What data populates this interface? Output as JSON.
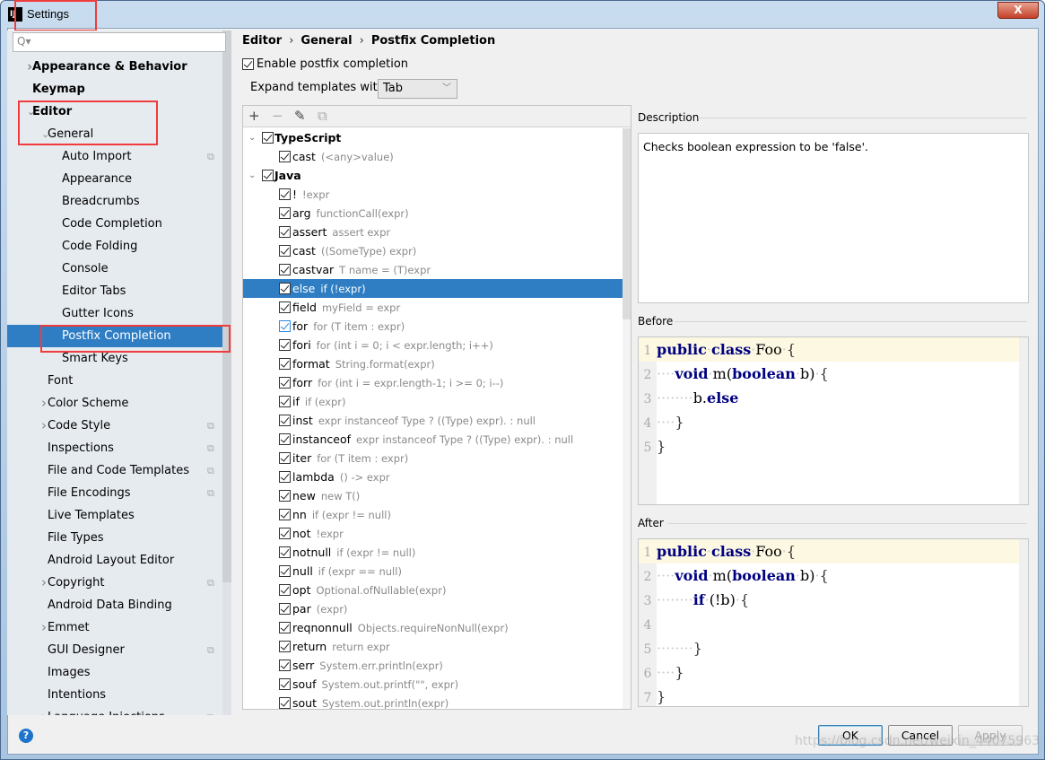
{
  "window": {
    "title": "Settings",
    "close_label": "X"
  },
  "search": {
    "placeholder": "Q▾"
  },
  "sidebar": {
    "items": [
      {
        "label": "Appearance & Behavior",
        "level": 0,
        "bold": true,
        "arrow": "collapsed"
      },
      {
        "label": "Keymap",
        "level": 0,
        "bold": true
      },
      {
        "label": "Editor",
        "level": 0,
        "bold": true,
        "arrow": "expanded"
      },
      {
        "label": "General",
        "level": 1,
        "arrow": "expanded"
      },
      {
        "label": "Auto Import",
        "level": 2,
        "copy": true
      },
      {
        "label": "Appearance",
        "level": 2
      },
      {
        "label": "Breadcrumbs",
        "level": 2
      },
      {
        "label": "Code Completion",
        "level": 2
      },
      {
        "label": "Code Folding",
        "level": 2
      },
      {
        "label": "Console",
        "level": 2
      },
      {
        "label": "Editor Tabs",
        "level": 2
      },
      {
        "label": "Gutter Icons",
        "level": 2
      },
      {
        "label": "Postfix Completion",
        "level": 2,
        "selected": true
      },
      {
        "label": "Smart Keys",
        "level": 2
      },
      {
        "label": "Font",
        "level": 1
      },
      {
        "label": "Color Scheme",
        "level": 1,
        "arrow": "collapsed"
      },
      {
        "label": "Code Style",
        "level": 1,
        "arrow": "collapsed",
        "copy": true
      },
      {
        "label": "Inspections",
        "level": 1,
        "copy": true
      },
      {
        "label": "File and Code Templates",
        "level": 1,
        "copy": true
      },
      {
        "label": "File Encodings",
        "level": 1,
        "copy": true
      },
      {
        "label": "Live Templates",
        "level": 1
      },
      {
        "label": "File Types",
        "level": 1
      },
      {
        "label": "Android Layout Editor",
        "level": 1
      },
      {
        "label": "Copyright",
        "level": 1,
        "arrow": "collapsed",
        "copy": true
      },
      {
        "label": "Android Data Binding",
        "level": 1
      },
      {
        "label": "Emmet",
        "level": 1,
        "arrow": "collapsed"
      },
      {
        "label": "GUI Designer",
        "level": 1,
        "copy": true
      },
      {
        "label": "Images",
        "level": 1
      },
      {
        "label": "Intentions",
        "level": 1
      },
      {
        "label": "Language Injections",
        "level": 1,
        "arrow": "collapsed",
        "copy": true
      }
    ]
  },
  "breadcrumb": [
    "Editor",
    "General",
    "Postfix Completion"
  ],
  "enable": {
    "label": "Enable postfix completion",
    "checked": true
  },
  "expand": {
    "label": "Expand templates with",
    "value": "Tab"
  },
  "toolbar": {
    "add": "+",
    "remove": "−",
    "edit": "✎",
    "copy": "⧉"
  },
  "templates": [
    {
      "group": "TypeScript",
      "checked": true,
      "items": [
        {
          "key": "cast",
          "desc": "(<any>value)",
          "checked": true
        }
      ]
    },
    {
      "group": "Java",
      "checked": true,
      "items": [
        {
          "key": "!",
          "desc": "!expr",
          "checked": true
        },
        {
          "key": "arg",
          "desc": "functionCall(expr)",
          "checked": true
        },
        {
          "key": "assert",
          "desc": "assert expr",
          "checked": true
        },
        {
          "key": "cast",
          "desc": "((SomeType) expr)",
          "checked": true
        },
        {
          "key": "castvar",
          "desc": "T name = (T)expr",
          "checked": true
        },
        {
          "key": "else",
          "desc": "if (!expr)",
          "checked": true,
          "selected": true
        },
        {
          "key": "field",
          "desc": "myField = expr",
          "checked": true
        },
        {
          "key": "for",
          "desc": "for (T item : expr)",
          "checked": true,
          "focused": true
        },
        {
          "key": "fori",
          "desc": "for (int i = 0; i < expr.length; i++)",
          "checked": true
        },
        {
          "key": "format",
          "desc": "String.format(expr)",
          "checked": true
        },
        {
          "key": "forr",
          "desc": "for (int i = expr.length-1; i >= 0; i--)",
          "checked": true
        },
        {
          "key": "if",
          "desc": "if (expr)",
          "checked": true
        },
        {
          "key": "inst",
          "desc": "expr instanceof Type ? ((Type) expr). : null",
          "checked": true
        },
        {
          "key": "instanceof",
          "desc": "expr instanceof Type ? ((Type) expr). : null",
          "checked": true
        },
        {
          "key": "iter",
          "desc": "for (T item : expr)",
          "checked": true
        },
        {
          "key": "lambda",
          "desc": "() -> expr",
          "checked": true
        },
        {
          "key": "new",
          "desc": "new T()",
          "checked": true
        },
        {
          "key": "nn",
          "desc": "if (expr != null)",
          "checked": true
        },
        {
          "key": "not",
          "desc": "!expr",
          "checked": true
        },
        {
          "key": "notnull",
          "desc": "if (expr != null)",
          "checked": true
        },
        {
          "key": "null",
          "desc": "if (expr == null)",
          "checked": true
        },
        {
          "key": "opt",
          "desc": "Optional.ofNullable(expr)",
          "checked": true
        },
        {
          "key": "par",
          "desc": "(expr)",
          "checked": true
        },
        {
          "key": "reqnonnull",
          "desc": "Objects.requireNonNull(expr)",
          "checked": true
        },
        {
          "key": "return",
          "desc": "return expr",
          "checked": true
        },
        {
          "key": "serr",
          "desc": "System.err.println(expr)",
          "checked": true
        },
        {
          "key": "souf",
          "desc": "System.out.printf(\"\", expr)",
          "checked": true
        },
        {
          "key": "sout",
          "desc": "System.out.println(expr)",
          "checked": true
        }
      ]
    }
  ],
  "description": {
    "label": "Description",
    "text": "Checks boolean expression to be 'false'."
  },
  "before": {
    "label": "Before",
    "lines": [
      [
        [
          "kw",
          "public"
        ],
        [
          "ws",
          "·"
        ],
        [
          "kw",
          "class"
        ],
        [
          "ws",
          "·"
        ],
        [
          "",
          "Foo"
        ],
        [
          "ws",
          "·"
        ],
        [
          "br",
          "{"
        ]
      ],
      [
        [
          "ws",
          "····"
        ],
        [
          "kw",
          "void"
        ],
        [
          "ws",
          "·"
        ],
        [
          "",
          "m("
        ],
        [
          "kw",
          "boolean"
        ],
        [
          "ws",
          "·"
        ],
        [
          "",
          "b)"
        ],
        [
          "ws",
          "·"
        ],
        [
          "br",
          "{"
        ]
      ],
      [
        [
          "ws",
          "········"
        ],
        [
          "",
          "b."
        ],
        [
          "kw",
          "else"
        ]
      ],
      [
        [
          "ws",
          "····"
        ],
        [
          "br",
          "}"
        ]
      ],
      [
        [
          "br",
          "}"
        ]
      ]
    ]
  },
  "after": {
    "label": "After",
    "lines": [
      [
        [
          "kw",
          "public"
        ],
        [
          "ws",
          "·"
        ],
        [
          "kw",
          "class"
        ],
        [
          "ws",
          "·"
        ],
        [
          "",
          "Foo"
        ],
        [
          "ws",
          "·"
        ],
        [
          "br",
          "{"
        ]
      ],
      [
        [
          "ws",
          "····"
        ],
        [
          "kw",
          "void"
        ],
        [
          "ws",
          "·"
        ],
        [
          "",
          "m("
        ],
        [
          "kw",
          "boolean"
        ],
        [
          "ws",
          "·"
        ],
        [
          "",
          "b)"
        ],
        [
          "ws",
          "·"
        ],
        [
          "br",
          "{"
        ]
      ],
      [
        [
          "ws",
          "········"
        ],
        [
          "kw",
          "if"
        ],
        [
          "ws",
          "·"
        ],
        [
          "",
          "(!b)"
        ],
        [
          "ws",
          "·"
        ],
        [
          "br",
          "{"
        ]
      ],
      [],
      [
        [
          "ws",
          "········"
        ],
        [
          "br",
          "}"
        ]
      ],
      [
        [
          "ws",
          "····"
        ],
        [
          "br",
          "}"
        ]
      ],
      [
        [
          "br",
          "}"
        ]
      ]
    ]
  },
  "footer": {
    "help": "?",
    "ok": "OK",
    "cancel": "Cancel",
    "apply": "Apply"
  },
  "watermark": "https://blog.csdn.net/weixin_44075963",
  "colors": {
    "selection": "#2f7ec4",
    "keyword": "#000080",
    "highlight_box": "#f03c3c"
  }
}
